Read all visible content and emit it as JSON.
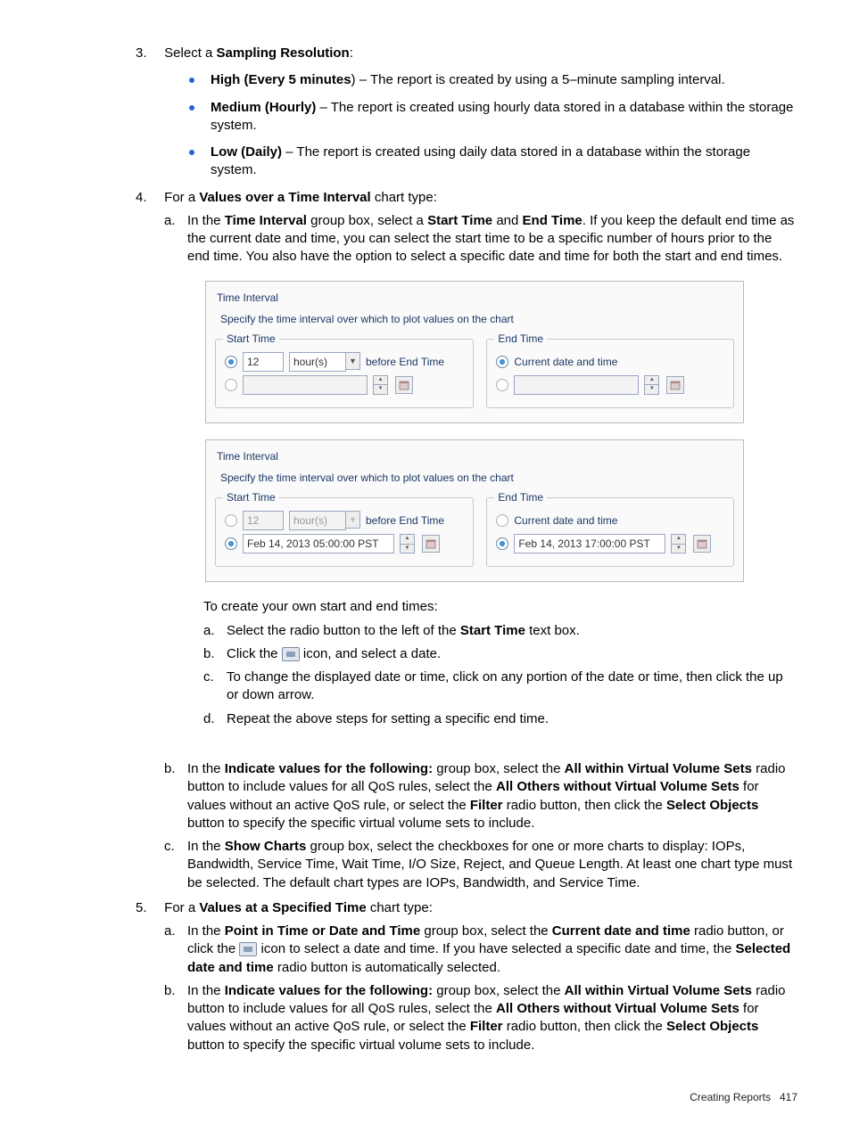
{
  "step3": {
    "num": "3.",
    "text_prefix": "Select a ",
    "text_bold": "Sampling Resolution",
    "text_suffix": ":",
    "bullets": [
      {
        "bold": "High (Every 5 minutes",
        "paren": ")",
        "rest": " – The report is created by using a 5–minute sampling interval."
      },
      {
        "bold": "Medium (Hourly)",
        "paren": "",
        "rest": " – The report is created using hourly data stored in a database within the storage system."
      },
      {
        "bold": "Low (Daily)",
        "paren": "",
        "rest": " – The report is created using daily data stored in a database within the storage system."
      }
    ]
  },
  "step4": {
    "num": "4.",
    "prefix": "For a ",
    "bold": "Values over a Time Interval",
    "suffix": " chart type:",
    "a": {
      "letter": "a.",
      "html": "In the <b>Time Interval</b> group box, select a <b>Start Time</b> and <b>End Time</b>. If you keep the default end time as the current date and time, you can select the start time to be a specific number of hours prior to the end time. You also have the option to select a specific date and time for both the start and end times."
    },
    "intro_after_dialog": "To create your own start and end times:",
    "subs": [
      {
        "l": "a.",
        "html": "Select the radio button to the left of the <b>Start Time</b> text box."
      },
      {
        "l": "b.",
        "html": "Click the <span class=\"inline-cal\" data-name=\"calendar-icon\" data-interactable=\"false\"></span> icon, and select a date."
      },
      {
        "l": "c.",
        "html": "To change the displayed date or time, click on any portion of the date or time, then click the up or down arrow."
      },
      {
        "l": "d.",
        "html": "Repeat the above steps for setting a specific end time."
      }
    ],
    "b": {
      "letter": "b.",
      "html": "In the <b>Indicate values for the following:</b> group box, select the <b>All within Virtual Volume Sets</b> radio button to include values for all QoS rules, select the <b>All Others without Virtual Volume Sets</b> for values without an active QoS rule, or select the <b>Filter</b> radio button, then click the <b>Select Objects</b> button to specify the specific virtual volume sets to include."
    },
    "c": {
      "letter": "c.",
      "html": "In the <b>Show Charts</b> group box, select the checkboxes for one or more charts to display: IOPs, Bandwidth, Service Time, Wait Time, I/O Size, Reject, and Queue Length. At least one chart type must be selected. The default chart types are IOPs, Bandwidth, and Service Time."
    }
  },
  "step5": {
    "num": "5.",
    "prefix": "For a ",
    "bold": "Values at a Specified Time",
    "suffix": " chart type:",
    "a": {
      "letter": "a.",
      "html": "In the <b>Point in Time or Date and Time</b> group box, select the <b>Current date and time</b> radio button, or click the <span class=\"inline-cal\" data-name=\"calendar-icon\" data-interactable=\"false\"></span> icon to select a date and time. If you have selected a specific date and time, the <b>Selected date and time</b> radio button is automatically selected."
    },
    "b": {
      "letter": "b.",
      "html": "In the <b>Indicate values for the following:</b> group box, select the <b>All within Virtual Volume Sets</b> radio button to include values for all QoS rules, select the <b>All Others without Virtual Volume Sets</b> for values without an active QoS rule, or select the <b>Filter</b> radio button, then click the <b>Select Objects</b> button to specify the specific virtual volume sets to include."
    }
  },
  "dialog1": {
    "title": "Time Interval",
    "desc": "Specify the time interval over which to plot values on the chart",
    "start_legend": "Start Time",
    "end_legend": "End Time",
    "row1_val": "12",
    "row1_unit": "hour(s)",
    "row1_suffix": "before End Time",
    "end_current": "Current date and time"
  },
  "dialog2": {
    "title": "Time Interval",
    "desc": "Specify the time interval over which to plot values on the chart",
    "start_legend": "Start Time",
    "end_legend": "End Time",
    "row1_val": "12",
    "row1_unit": "hour(s)",
    "row1_suffix": "before End Time",
    "start_date": "Feb 14, 2013 05:00:00 PST",
    "end_current": "Current date and time",
    "end_date": "Feb 14, 2013 17:00:00 PST"
  },
  "footer": {
    "label": "Creating Reports",
    "page": "417"
  }
}
